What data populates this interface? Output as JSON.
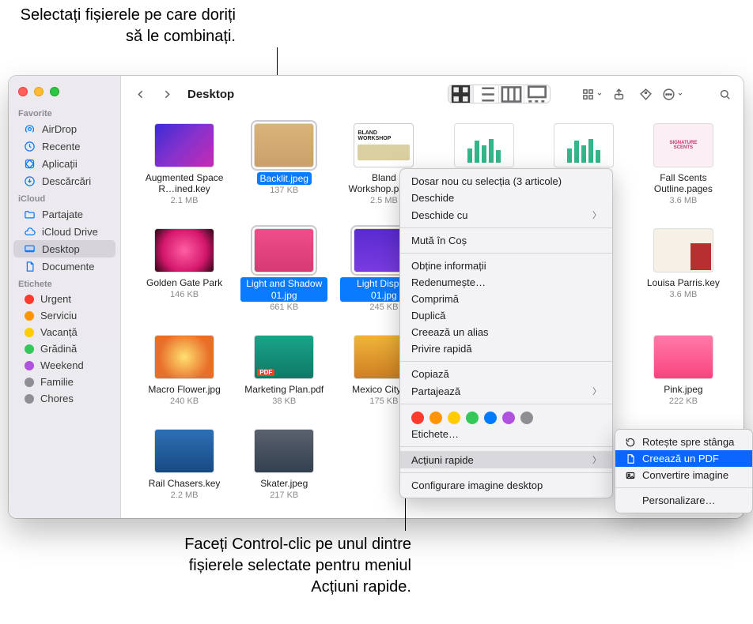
{
  "callouts": {
    "top": "Selectați fișierele pe care doriți să le combinați.",
    "bottom": "Faceți Control-clic pe unul dintre fișierele selectate pentru meniul Acțiuni rapide."
  },
  "window": {
    "title": "Desktop"
  },
  "sidebar": {
    "sections": {
      "favorite": "Favorite",
      "icloud": "iCloud",
      "tags": "Etichete"
    },
    "favorite": [
      {
        "label": "AirDrop"
      },
      {
        "label": "Recente"
      },
      {
        "label": "Aplicații"
      },
      {
        "label": "Descărcări"
      }
    ],
    "icloud": [
      {
        "label": "Partajate"
      },
      {
        "label": "iCloud Drive"
      },
      {
        "label": "Desktop"
      },
      {
        "label": "Documente"
      }
    ],
    "tags": [
      {
        "label": "Urgent",
        "color": "#ff3b30"
      },
      {
        "label": "Serviciu",
        "color": "#ff9500"
      },
      {
        "label": "Vacanță",
        "color": "#ffcc00"
      },
      {
        "label": "Grădină",
        "color": "#34c759"
      },
      {
        "label": "Weekend",
        "color": "#af52de"
      },
      {
        "label": "Familie",
        "color": "#8e8e93"
      },
      {
        "label": "Chores",
        "color": "#8e8e93"
      }
    ]
  },
  "files": [
    {
      "name": "Augmented Space R…ined.key",
      "sub": "2.1 MB",
      "sel": false,
      "cls": "th-grad1"
    },
    {
      "name": "Backlit.jpeg",
      "sub": "137 KB",
      "sel": true,
      "cls": "th-photo"
    },
    {
      "name": "Bland Workshop.pages",
      "sub": "2.5 MB",
      "sel": false,
      "cls": "th-doc"
    },
    {
      "name": "",
      "sub": "",
      "sel": false,
      "cls": "th-chart"
    },
    {
      "name": "",
      "sub": "",
      "sel": false,
      "cls": "th-chart"
    },
    {
      "name": "Fall Scents Outline.pages",
      "sub": "3.6 MB",
      "sel": false,
      "cls": "th-scent"
    },
    {
      "name": "Golden Gate Park",
      "sub": "146 KB",
      "sel": false,
      "cls": "th-pinkfl"
    },
    {
      "name": "Light and Shadow 01.jpg",
      "sub": "661 KB",
      "sel": true,
      "cls": "th-hand"
    },
    {
      "name": "Light Display 01.jpg",
      "sub": "245 KB",
      "sel": true,
      "cls": "th-purple"
    },
    {
      "name": "",
      "sub": "",
      "sel": false,
      "cls": ""
    },
    {
      "name": "",
      "sub": "",
      "sel": false,
      "cls": ""
    },
    {
      "name": "Louisa Parris.key",
      "sub": "3.6 MB",
      "sel": false,
      "cls": "th-lp"
    },
    {
      "name": "Macro Flower.jpg",
      "sub": "240 KB",
      "sel": false,
      "cls": "th-macro"
    },
    {
      "name": "Marketing Plan.pdf",
      "sub": "38 KB",
      "sel": false,
      "cls": "th-mkplan",
      "pdf": true
    },
    {
      "name": "Mexico City.jpg",
      "sub": "175 KB",
      "sel": false,
      "cls": "th-mex"
    },
    {
      "name": "",
      "sub": "",
      "sel": false,
      "cls": ""
    },
    {
      "name": "",
      "sub": "",
      "sel": false,
      "cls": ""
    },
    {
      "name": "Pink.jpeg",
      "sub": "222 KB",
      "sel": false,
      "cls": "th-pink"
    },
    {
      "name": "Rail Chasers.key",
      "sub": "2.2 MB",
      "sel": false,
      "cls": "th-rail"
    },
    {
      "name": "Skater.jpeg",
      "sub": "217 KB",
      "sel": false,
      "cls": "th-skater"
    }
  ],
  "ctx": {
    "i0": "Dosar nou cu selecția (3 articole)",
    "i1": "Deschide",
    "i2": "Deschide cu",
    "i3": "Mută în Coș",
    "i4": "Obține informații",
    "i5": "Redenumește…",
    "i6": "Comprimă",
    "i7": "Duplică",
    "i8": "Creează un alias",
    "i9": "Privire rapidă",
    "i10": "Copiază",
    "i11": "Partajează",
    "i12": "Etichete…",
    "i13": "Acțiuni rapide",
    "i14": "Configurare imagine desktop",
    "tagcolors": [
      "#ff3b30",
      "#ff9500",
      "#ffcc00",
      "#34c759",
      "#007aff",
      "#af52de",
      "#8e8e93"
    ]
  },
  "sub": {
    "s0": "Rotește spre stânga",
    "s1": "Creează un PDF",
    "s2": "Convertire imagine",
    "s3": "Personalizare…"
  }
}
